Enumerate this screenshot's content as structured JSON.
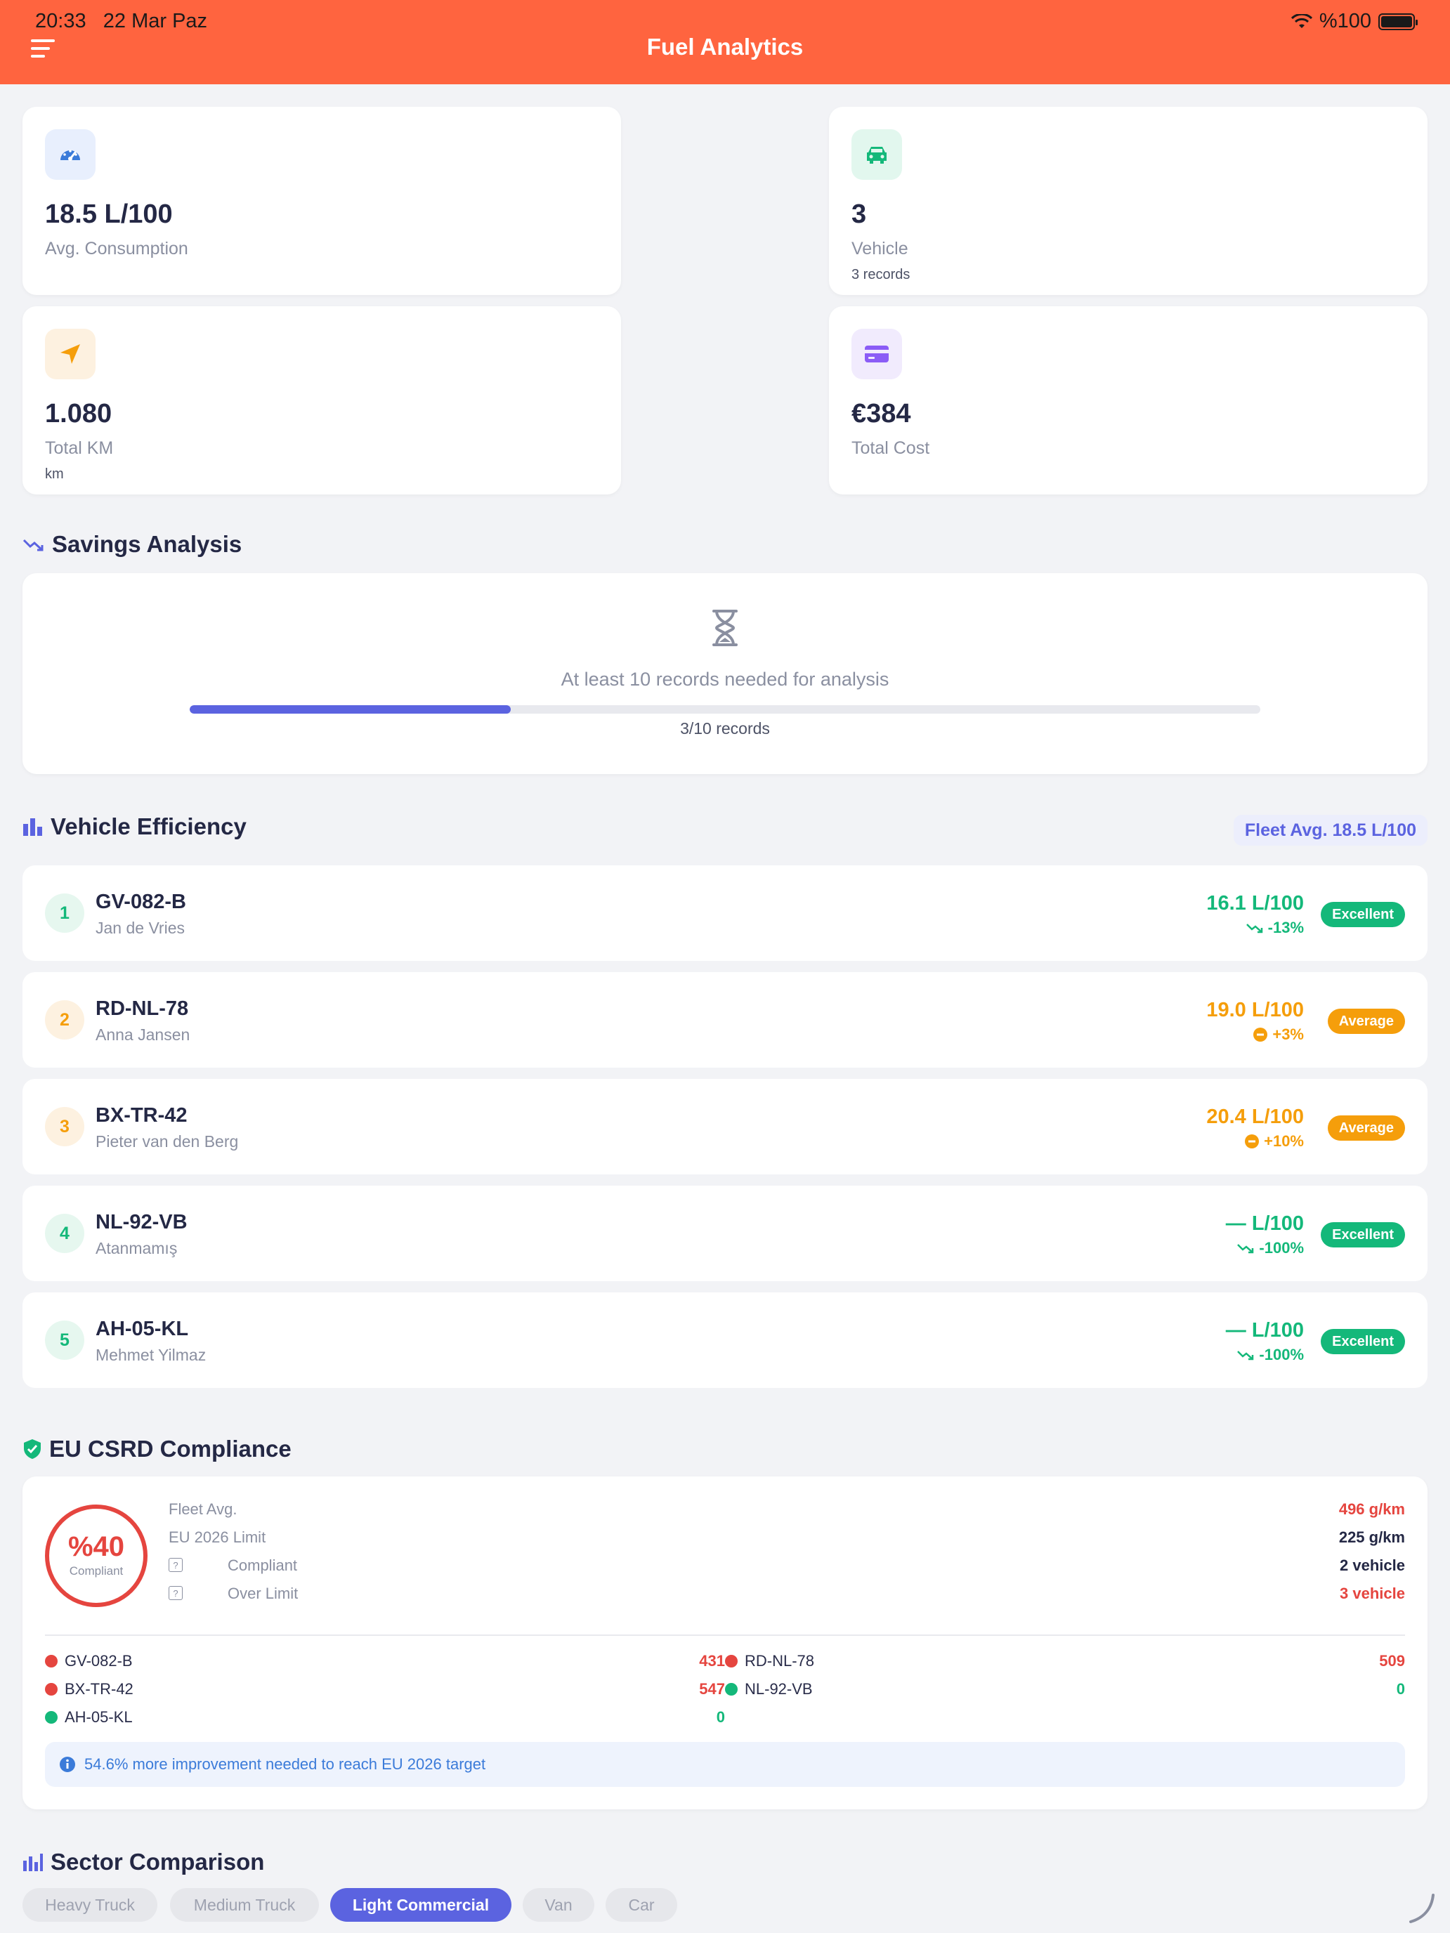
{
  "status_bar": {
    "time": "20:33",
    "date": "22 Mar Paz",
    "battery": "%100"
  },
  "header": {
    "title": "Fuel Analytics"
  },
  "stats": {
    "avg_consumption": {
      "value": "18.5 L/100",
      "label": "Avg. Consumption"
    },
    "vehicle": {
      "value": "3",
      "label": "Vehicle",
      "sub": "3 records"
    },
    "total_km": {
      "value": "1.080",
      "label": "Total KM",
      "sub": "km"
    },
    "total_cost": {
      "value": "€384",
      "label": "Total Cost"
    }
  },
  "savings": {
    "title": "Savings Analysis",
    "message": "At least 10 records needed for analysis",
    "progress": 0.3,
    "progress_label": "3/10 records"
  },
  "efficiency": {
    "title": "Vehicle Efficiency",
    "fleet_avg": "Fleet Avg. 18.5 L/100",
    "vehicles": [
      {
        "rank": "1",
        "plate": "GV-082-B",
        "driver": "Jan de Vries",
        "consumption": "16.1 L/100",
        "delta": "-13%",
        "badge": "Excellent"
      },
      {
        "rank": "2",
        "plate": "RD-NL-78",
        "driver": "Anna Jansen",
        "consumption": "19.0 L/100",
        "delta": "+3%",
        "badge": "Average"
      },
      {
        "rank": "3",
        "plate": "BX-TR-42",
        "driver": "Pieter van den Berg",
        "consumption": "20.4 L/100",
        "delta": "+10%",
        "badge": "Average"
      },
      {
        "rank": "4",
        "plate": "NL-92-VB",
        "driver": "Atanmamış",
        "consumption": "— L/100",
        "delta": "-100%",
        "badge": "Excellent"
      },
      {
        "rank": "5",
        "plate": "AH-05-KL",
        "driver": "Mehmet Yilmaz",
        "consumption": "— L/100",
        "delta": "-100%",
        "badge": "Excellent"
      }
    ]
  },
  "compliance": {
    "title": "EU CSRD Compliance",
    "gauge_value": "%40",
    "gauge_label": "Compliant",
    "fleet_avg_label": "Fleet Avg.",
    "fleet_avg_value": "496 g/km",
    "limit_label": "EU 2026 Limit",
    "limit_value": "225 g/km",
    "compliant_label": "Compliant",
    "compliant_value": "2 vehicle",
    "over_label": "Over Limit",
    "over_value": "3 vehicle",
    "vehicles": [
      {
        "plate": "GV-082-B",
        "value": "431"
      },
      {
        "plate": "RD-NL-78",
        "value": "509"
      },
      {
        "plate": "BX-TR-42",
        "value": "547"
      },
      {
        "plate": "NL-92-VB",
        "value": "0"
      },
      {
        "plate": "AH-05-KL",
        "value": "0"
      }
    ],
    "info": "54.6% more improvement needed to reach EU 2026 target"
  },
  "sector": {
    "title": "Sector Comparison",
    "tabs": [
      "Heavy Truck",
      "Medium Truck",
      "Light Commercial",
      "Van",
      "Car"
    ],
    "active_tab": "Light Commercial"
  },
  "colors": {
    "brand": "#ff643f",
    "accent": "#5b63e0",
    "excellent": "#14b87a",
    "average": "#f59e0b",
    "danger": "#e5453f"
  }
}
